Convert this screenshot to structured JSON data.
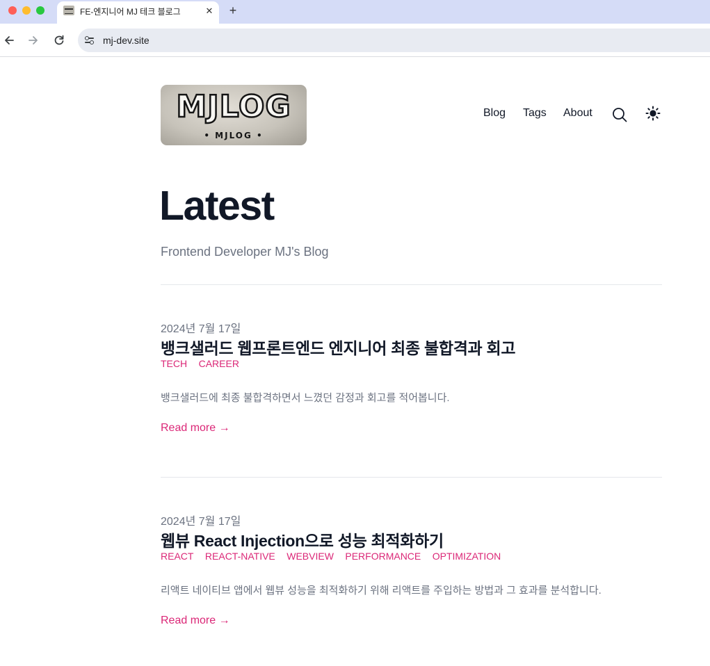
{
  "browser": {
    "tab_title": "FE-엔지니어 MJ 테크 블로그",
    "tab_close_glyph": "✕",
    "new_tab_glyph": "+",
    "url": "mj-dev.site",
    "nav_icons": [
      "back-arrow-icon",
      "forward-arrow-icon",
      "reload-icon",
      "site-info-icon"
    ]
  },
  "header": {
    "logo": {
      "main_text": "MJLOG",
      "sub_text": "• MJLOG •"
    },
    "nav": [
      {
        "label": "Blog"
      },
      {
        "label": "Tags"
      },
      {
        "label": "About"
      }
    ],
    "icons": [
      "search-icon",
      "sun-icon"
    ]
  },
  "main": {
    "title": "Latest",
    "subtitle": "Frontend Developer MJ's Blog",
    "posts": [
      {
        "date": "2024년 7월 17일",
        "title": "뱅크샐러드 웹프론트엔드 엔지니어 최종 불합격과 회고",
        "tags": [
          "TECH",
          "CAREER"
        ],
        "summary": "뱅크샐러드에 최종 불합격하면서 느꼈던 감정과 회고를 적어봅니다.",
        "read_more": "Read more →"
      },
      {
        "date": "2024년 7월 17일",
        "title": "웹뷰 React Injection으로 성능 최적화하기",
        "tags": [
          "REACT",
          "REACT-NATIVE",
          "WEBVIEW",
          "PERFORMANCE",
          "OPTIMIZATION"
        ],
        "summary": "리액트 네이티브 앱에서 웹뷰 성능을 최적화하기 위해 리액트를 주입하는 방법과 그 효과를 분석합니다.",
        "read_more": "Read more →"
      }
    ]
  },
  "colors": {
    "accent": "#db2777",
    "heading": "#111827",
    "muted": "#6b7280",
    "tabbar": "#d5dcf7"
  }
}
